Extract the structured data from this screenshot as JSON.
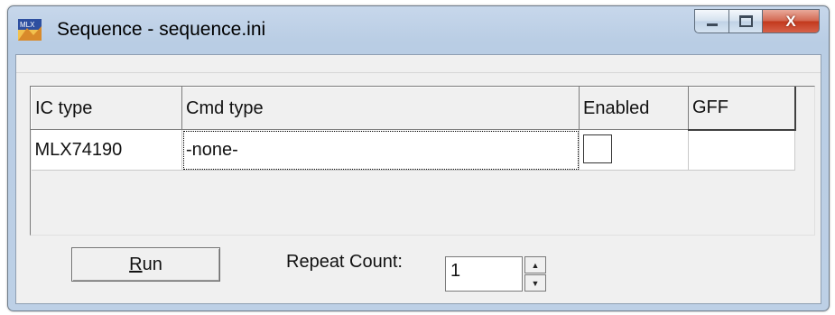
{
  "window": {
    "title": "Sequence - sequence.ini",
    "app_icon": "mlx-app-icon",
    "controls": {
      "minimize": "—",
      "maximize": "□",
      "close": "X"
    }
  },
  "grid": {
    "columns": [
      "IC type",
      "Cmd type",
      "Enabled",
      "GFF"
    ],
    "rows": [
      {
        "ic_type": "MLX74190",
        "cmd_type": "-none-",
        "enabled": false,
        "gff": ""
      }
    ]
  },
  "footer": {
    "run_label_underlined": "R",
    "run_label_rest": "un",
    "repeat_label": "Repeat Count:",
    "repeat_value": "1"
  },
  "colors": {
    "frame": "#bdd0e6",
    "close_button": "#c7402a",
    "client_bg": "#f0f0f0"
  }
}
